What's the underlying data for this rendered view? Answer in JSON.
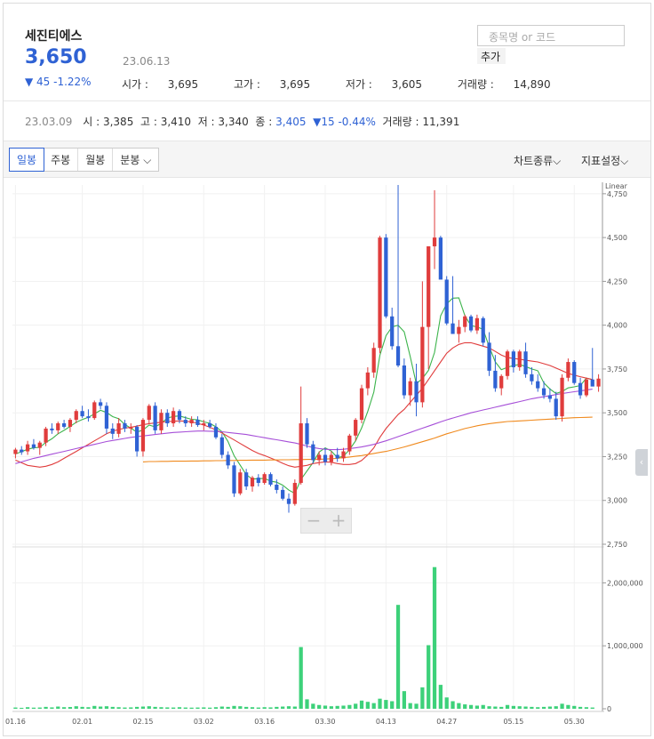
{
  "stock": {
    "name": "세진티에스",
    "price": "3,650",
    "date": "23.06.13",
    "change": "▼ 45 -1.22%",
    "open_label": "시가 : ",
    "open": "3,695",
    "high_label": "고가 : ",
    "high": "3,695",
    "low_label": "저가 : ",
    "low": "3,605",
    "volume_label": "거래량 : ",
    "volume": "14,890"
  },
  "search": {
    "placeholder": "종목명 or 코드",
    "add_label": "추가"
  },
  "prev_day": {
    "date": "23.03.09",
    "open": "시 : 3,385",
    "high": "고 : 3,410",
    "low": "저 : 3,340",
    "close_label": "종 : ",
    "close": "3,405",
    "change": "▼15 -0.44%",
    "volume": "거래량 : 11,391"
  },
  "toolbar": {
    "tabs": [
      "일봉",
      "주봉",
      "월봉",
      "분봉"
    ],
    "chart_type": "차트종류",
    "indicator": "지표설정"
  },
  "zoom": {
    "minus": "−",
    "plus": "+"
  },
  "colors": {
    "up": "#e03c3c",
    "down": "#2f62d4",
    "ma5": "#3cb44b",
    "ma20": "#e03c3c",
    "ma60": "#a64fd8",
    "ma120": "#f08a1e",
    "volume": "#3dd17a"
  },
  "chart_data": {
    "type": "candlestick",
    "scale_label": "Linear",
    "price_ylim": [
      2750,
      4800
    ],
    "price_ticks": [
      "2,750",
      "3,000",
      "3,250",
      "3,500",
      "3,750",
      "4,000",
      "4,250",
      "4,500",
      "4,750"
    ],
    "volume_ylim": [
      0,
      2500000
    ],
    "volume_ticks": [
      "0",
      "1,000,000",
      "2,000,000"
    ],
    "x_ticks": [
      "01.16",
      "02.01",
      "02.15",
      "03.02",
      "03.16",
      "03.30",
      "04.13",
      "04.27",
      "05.15",
      "05.30"
    ],
    "x_tick_index": [
      0,
      11,
      21,
      31,
      41,
      51,
      61,
      71,
      82,
      92
    ],
    "candles": [
      [
        3265,
        3300,
        3240,
        3290
      ],
      [
        3290,
        3310,
        3260,
        3275
      ],
      [
        3280,
        3340,
        3260,
        3320
      ],
      [
        3320,
        3350,
        3290,
        3300
      ],
      [
        3300,
        3340,
        3260,
        3330
      ],
      [
        3330,
        3420,
        3310,
        3410
      ],
      [
        3410,
        3440,
        3380,
        3400
      ],
      [
        3400,
        3450,
        3380,
        3440
      ],
      [
        3440,
        3460,
        3410,
        3420
      ],
      [
        3420,
        3470,
        3390,
        3460
      ],
      [
        3460,
        3520,
        3440,
        3510
      ],
      [
        3510,
        3540,
        3470,
        3480
      ],
      [
        3480,
        3520,
        3450,
        3470
      ],
      [
        3470,
        3570,
        3460,
        3560
      ],
      [
        3560,
        3580,
        3520,
        3540
      ],
      [
        3540,
        3560,
        3380,
        3410
      ],
      [
        3410,
        3440,
        3350,
        3380
      ],
      [
        3380,
        3470,
        3360,
        3440
      ],
      [
        3440,
        3460,
        3390,
        3410
      ],
      [
        3410,
        3440,
        3380,
        3420
      ],
      [
        3420,
        3430,
        3250,
        3280
      ],
      [
        3280,
        3470,
        3250,
        3460
      ],
      [
        3460,
        3550,
        3440,
        3540
      ],
      [
        3540,
        3560,
        3380,
        3400
      ],
      [
        3400,
        3520,
        3380,
        3500
      ],
      [
        3500,
        3520,
        3420,
        3440
      ],
      [
        3440,
        3530,
        3420,
        3510
      ],
      [
        3510,
        3520,
        3440,
        3460
      ],
      [
        3460,
        3480,
        3420,
        3440
      ],
      [
        3440,
        3480,
        3420,
        3460
      ],
      [
        3460,
        3480,
        3420,
        3430
      ],
      [
        3430,
        3460,
        3400,
        3440
      ],
      [
        3440,
        3460,
        3410,
        3420
      ],
      [
        3420,
        3440,
        3350,
        3360
      ],
      [
        3360,
        3380,
        3240,
        3260
      ],
      [
        3260,
        3280,
        3180,
        3200
      ],
      [
        3200,
        3220,
        3020,
        3040
      ],
      [
        3040,
        3180,
        3030,
        3160
      ],
      [
        3160,
        3180,
        3060,
        3080
      ],
      [
        3080,
        3140,
        3050,
        3130
      ],
      [
        3130,
        3150,
        3080,
        3100
      ],
      [
        3100,
        3160,
        3090,
        3150
      ],
      [
        3150,
        3160,
        3080,
        3090
      ],
      [
        3090,
        3120,
        3040,
        3060
      ],
      [
        3060,
        3080,
        3000,
        3010
      ],
      [
        3010,
        3040,
        2930,
        2980
      ],
      [
        2980,
        3120,
        2970,
        3100
      ],
      [
        3100,
        3650,
        3090,
        3440
      ],
      [
        3440,
        3470,
        3300,
        3320
      ],
      [
        3320,
        3340,
        3210,
        3230
      ],
      [
        3230,
        3280,
        3200,
        3260
      ],
      [
        3260,
        3300,
        3200,
        3220
      ],
      [
        3220,
        3280,
        3200,
        3260
      ],
      [
        3260,
        3300,
        3220,
        3240
      ],
      [
        3240,
        3300,
        3220,
        3280
      ],
      [
        3280,
        3380,
        3260,
        3370
      ],
      [
        3370,
        3470,
        3340,
        3460
      ],
      [
        3460,
        3660,
        3440,
        3640
      ],
      [
        3640,
        3760,
        3600,
        3730
      ],
      [
        3730,
        3900,
        3700,
        3870
      ],
      [
        3870,
        4510,
        3840,
        4500
      ],
      [
        4500,
        4520,
        4040,
        4050
      ],
      [
        4050,
        4100,
        3860,
        3880
      ],
      [
        3880,
        4800,
        3760,
        3770
      ],
      [
        3770,
        3810,
        3580,
        3600
      ],
      [
        3600,
        3700,
        3540,
        3680
      ],
      [
        3680,
        3780,
        3480,
        3560
      ],
      [
        3560,
        4250,
        3530,
        3990
      ],
      [
        3990,
        4350,
        3750,
        4450
      ],
      [
        4450,
        4770,
        4320,
        4500
      ],
      [
        4500,
        4510,
        4280,
        4260
      ],
      [
        4260,
        4280,
        4000,
        4010
      ],
      [
        4010,
        4280,
        3960,
        3950
      ],
      [
        3950,
        4030,
        3900,
        3990
      ],
      [
        3990,
        4060,
        3960,
        4050
      ],
      [
        4050,
        4060,
        3960,
        3970
      ],
      [
        3970,
        4060,
        3950,
        4040
      ],
      [
        4040,
        4050,
        3880,
        3900
      ],
      [
        3900,
        3960,
        3710,
        3740
      ],
      [
        3740,
        3830,
        3620,
        3640
      ],
      [
        3640,
        3720,
        3600,
        3710
      ],
      [
        3710,
        3860,
        3690,
        3850
      ],
      [
        3850,
        3860,
        3730,
        3760
      ],
      [
        3760,
        3860,
        3740,
        3850
      ],
      [
        3850,
        3900,
        3700,
        3720
      ],
      [
        3720,
        3760,
        3660,
        3680
      ],
      [
        3680,
        3720,
        3620,
        3640
      ],
      [
        3640,
        3680,
        3580,
        3600
      ],
      [
        3600,
        3640,
        3560,
        3580
      ],
      [
        3580,
        3620,
        3460,
        3480
      ],
      [
        3480,
        3720,
        3450,
        3700
      ],
      [
        3700,
        3810,
        3680,
        3790
      ],
      [
        3790,
        3800,
        3660,
        3670
      ],
      [
        3670,
        3700,
        3580,
        3600
      ],
      [
        3600,
        3700,
        3590,
        3690
      ],
      [
        3690,
        3870,
        3680,
        3650
      ],
      [
        3650,
        3720,
        3620,
        3695
      ]
    ],
    "volume": [
      20000,
      15000,
      25000,
      18000,
      20000,
      30000,
      22000,
      35000,
      25000,
      28000,
      40000,
      30000,
      25000,
      45000,
      35000,
      40000,
      30000,
      25000,
      20000,
      22000,
      30000,
      35000,
      40000,
      30000,
      25000,
      22000,
      20000,
      25000,
      20000,
      18000,
      20000,
      22000,
      18000,
      25000,
      35000,
      30000,
      45000,
      40000,
      30000,
      25000,
      20000,
      25000,
      22000,
      30000,
      35000,
      40000,
      35000,
      980000,
      150000,
      80000,
      60000,
      50000,
      40000,
      45000,
      50000,
      60000,
      80000,
      130000,
      110000,
      90000,
      160000,
      140000,
      120000,
      1650000,
      280000,
      90000,
      80000,
      340000,
      1010000,
      2250000,
      380000,
      180000,
      120000,
      90000,
      70000,
      60000,
      50000,
      60000,
      40000,
      35000,
      30000,
      60000,
      45000,
      40000,
      35000,
      30000,
      25000,
      30000,
      35000,
      40000,
      80000,
      60000,
      45000,
      30000,
      25000,
      20000
    ],
    "ma_lines": [
      {
        "period": 5,
        "values": [
          3265,
          3278,
          3292,
          3300,
          3303,
          3331,
          3352,
          3380,
          3400,
          3422,
          3446,
          3462,
          3474,
          3494,
          3514,
          3502,
          3478,
          3466,
          3434,
          3412,
          3390,
          3402,
          3430,
          3420,
          3440,
          3470,
          3479,
          3482,
          3472,
          3463,
          3460,
          3448,
          3440,
          3420,
          3392,
          3336,
          3255,
          3201,
          3147,
          3122,
          3124,
          3126,
          3110,
          3104,
          3087,
          3059,
          3040,
          3120,
          3168,
          3216,
          3276,
          3300,
          3282,
          3244,
          3252,
          3290,
          3340,
          3414,
          3508,
          3618,
          3828,
          3940,
          3990,
          4000,
          3962,
          3820,
          3666,
          3696,
          3742,
          3844,
          4054,
          4122,
          4154,
          4156,
          4054,
          3998,
          3990,
          3976,
          3876,
          3790,
          3746,
          3760,
          3770,
          3776,
          3764,
          3750,
          3740,
          3670,
          3636,
          3610,
          3622,
          3642,
          3648,
          3656,
          3698,
          3690
        ]
      },
      {
        "period": 20,
        "values": [
          3230,
          3215,
          3200,
          3195,
          3190,
          3195,
          3205,
          3220,
          3240,
          3260,
          3280,
          3300,
          3320,
          3340,
          3360,
          3380,
          3395,
          3405,
          3412,
          3418,
          3424,
          3432,
          3438,
          3442,
          3446,
          3450,
          3452,
          3454,
          3452,
          3448,
          3440,
          3430,
          3418,
          3402,
          3385,
          3365,
          3345,
          3325,
          3305,
          3285,
          3268,
          3256,
          3242,
          3228,
          3212,
          3198,
          3190,
          3195,
          3200,
          3210,
          3216,
          3220,
          3218,
          3210,
          3205,
          3205,
          3210,
          3228,
          3260,
          3300,
          3360,
          3410,
          3450,
          3490,
          3520,
          3560,
          3600,
          3640,
          3690,
          3740,
          3790,
          3840,
          3870,
          3890,
          3900,
          3900,
          3890,
          3880,
          3870,
          3850,
          3830,
          3815,
          3810,
          3806,
          3800,
          3795,
          3790,
          3780,
          3770,
          3755,
          3740,
          3725,
          3715,
          3706,
          3698,
          3690
        ]
      },
      {
        "period": 60,
        "values": [
          3210,
          3220,
          3230,
          3240,
          3248,
          3256,
          3264,
          3272,
          3280,
          3288,
          3296,
          3304,
          3312,
          3320,
          3328,
          3336,
          3342,
          3348,
          3354,
          3360,
          3364,
          3368,
          3372,
          3376,
          3380,
          3384,
          3388,
          3390,
          3392,
          3394,
          3396,
          3396,
          3395,
          3394,
          3392,
          3388,
          3384,
          3380,
          3376,
          3370,
          3364,
          3358,
          3352,
          3346,
          3340,
          3334,
          3328,
          3320,
          3310,
          3302,
          3296,
          3292,
          3290,
          3290,
          3292,
          3296,
          3300,
          3305,
          3312,
          3320,
          3330,
          3340,
          3352,
          3364,
          3376,
          3388,
          3400,
          3412,
          3424,
          3436,
          3448,
          3460,
          3470,
          3480,
          3490,
          3500,
          3508,
          3516,
          3524,
          3532,
          3540,
          3548,
          3556,
          3564,
          3572,
          3580,
          3586,
          3592,
          3598,
          3604,
          3610,
          3615,
          3620,
          3625,
          3630,
          3635
        ]
      },
      {
        "period": 120,
        "start": 21,
        "values": [
          3220,
          3222,
          3222,
          3223,
          3223,
          3224,
          3224,
          3224,
          3225,
          3225,
          3226,
          3226,
          3227,
          3227,
          3228,
          3228,
          3229,
          3229,
          3230,
          3230,
          3230,
          3231,
          3231,
          3232,
          3232,
          3233,
          3233,
          3234,
          3234,
          3235,
          3236,
          3238,
          3240,
          3244,
          3248,
          3252,
          3256,
          3262,
          3268,
          3274,
          3280,
          3288,
          3296,
          3305,
          3315,
          3325,
          3335,
          3345,
          3356,
          3368,
          3380,
          3390,
          3400,
          3410,
          3418,
          3426,
          3432,
          3438,
          3442,
          3446,
          3450,
          3452,
          3454,
          3456,
          3458,
          3460,
          3462,
          3464,
          3466,
          3468,
          3470,
          3472,
          3473,
          3474,
          3475
        ]
      }
    ]
  }
}
